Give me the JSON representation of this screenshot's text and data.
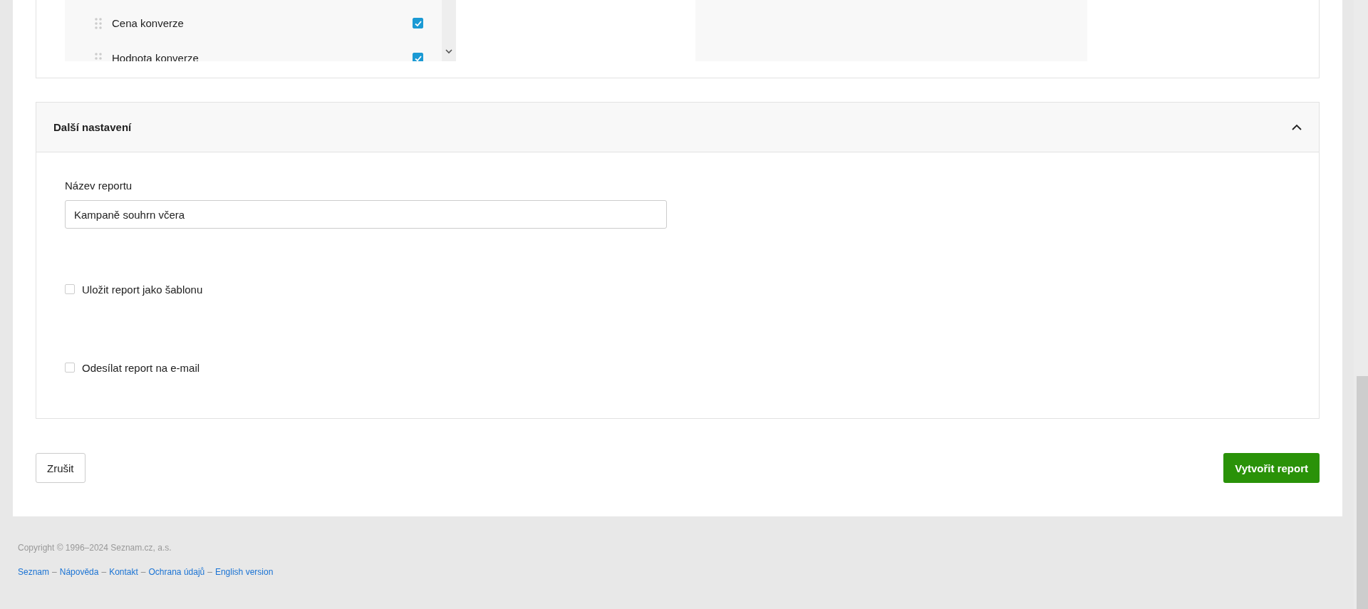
{
  "columns_list": {
    "items": [
      {
        "label": "Cena konverze",
        "checked": true
      },
      {
        "label": "Hodnota konverze",
        "checked": true
      }
    ]
  },
  "settings": {
    "title": "Další nastavení",
    "expanded": true,
    "report_name": {
      "label": "Název reportu",
      "value": "Kampaně souhrn včera"
    },
    "options": [
      {
        "label": "Uložit report jako šablonu",
        "checked": false
      },
      {
        "label": "Odesílat report na e-mail",
        "checked": false
      }
    ]
  },
  "actions": {
    "cancel": "Zrušit",
    "submit": "Vytvořit report"
  },
  "footer": {
    "copyright": "Copyright © 1996–2024 Seznam.cz, a.s.",
    "separator": "–",
    "links": [
      "Seznam",
      "Nápověda",
      "Kontakt",
      "Ochrana údajů",
      "English version"
    ]
  }
}
